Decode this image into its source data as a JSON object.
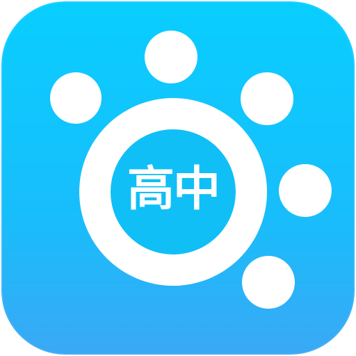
{
  "icon": {
    "label": "高中",
    "dot_icons": [
      "circle-dot-icon",
      "circle-dot-icon",
      "circle-dot-icon",
      "circle-dot-icon",
      "circle-dot-icon"
    ],
    "colors": {
      "background_top": "#08ceff",
      "background_bottom": "#3aa8f5",
      "foreground": "#ffffff",
      "inner_fill": "#10bff6"
    }
  }
}
